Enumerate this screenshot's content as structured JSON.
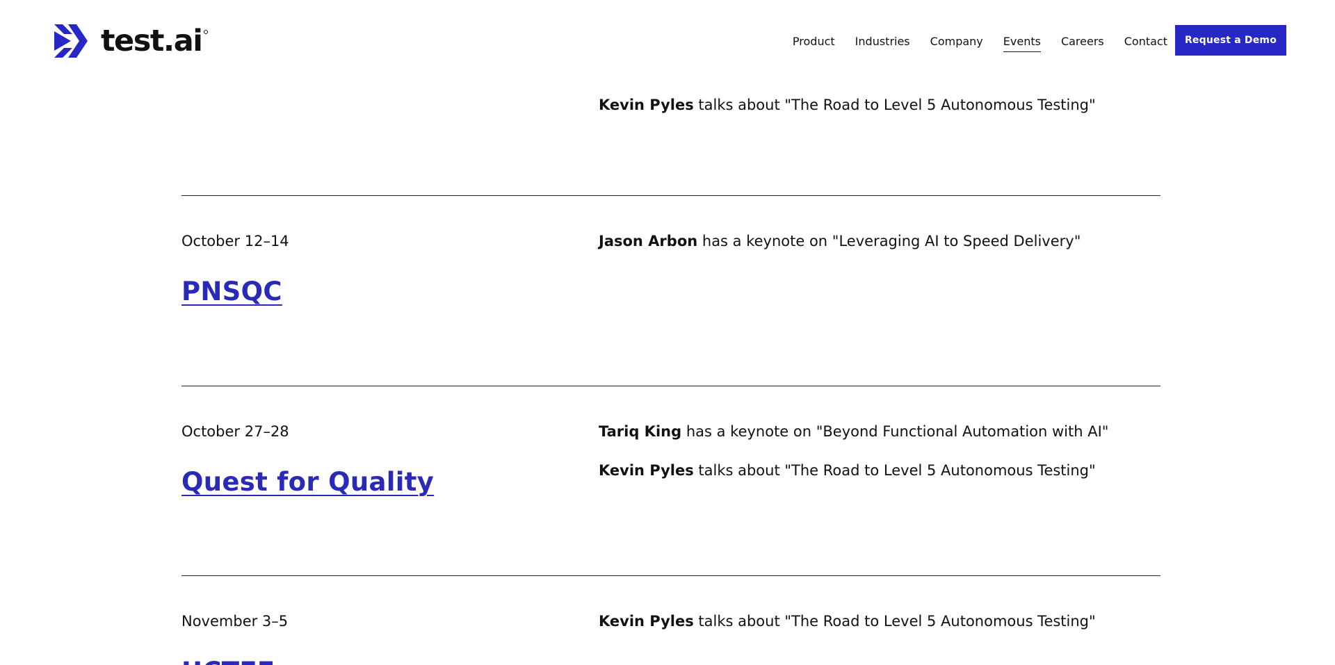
{
  "header": {
    "logo_text": "test.ai",
    "nav": [
      {
        "label": "Product",
        "active": false
      },
      {
        "label": "Industries",
        "active": false
      },
      {
        "label": "Company",
        "active": false
      },
      {
        "label": "Events",
        "active": true
      },
      {
        "label": "Careers",
        "active": false
      },
      {
        "label": "Contact",
        "active": false
      }
    ],
    "cta_label": "Request a Demo"
  },
  "colors": {
    "brand": "#2727c5",
    "link": "#2a2ab8",
    "text": "#111111"
  },
  "events": [
    {
      "date": "",
      "title": "",
      "speakers": [
        {
          "name": "Kevin Pyles",
          "text": " talks about \"The Road to Level 5 Autonomous Testing\""
        }
      ]
    },
    {
      "date": "October 12–14",
      "title": "PNSQC",
      "speakers": [
        {
          "name": "Jason Arbon",
          "text": " has a keynote on \"Leveraging AI to Speed Delivery\""
        }
      ]
    },
    {
      "date": "October 27–28",
      "title": "Quest for Quality",
      "speakers": [
        {
          "name": "Tariq King",
          "text": " has a keynote on \"Beyond Functional Automation with AI\""
        },
        {
          "name": "Kevin Pyles",
          "text": " talks about \"The Road to Level 5 Autonomous Testing\""
        }
      ]
    },
    {
      "date": "November 3–5",
      "title": "UCTEE",
      "speakers": [
        {
          "name": "Kevin Pyles",
          "text": " talks about \"The Road to Level 5 Autonomous Testing\""
        }
      ]
    }
  ]
}
